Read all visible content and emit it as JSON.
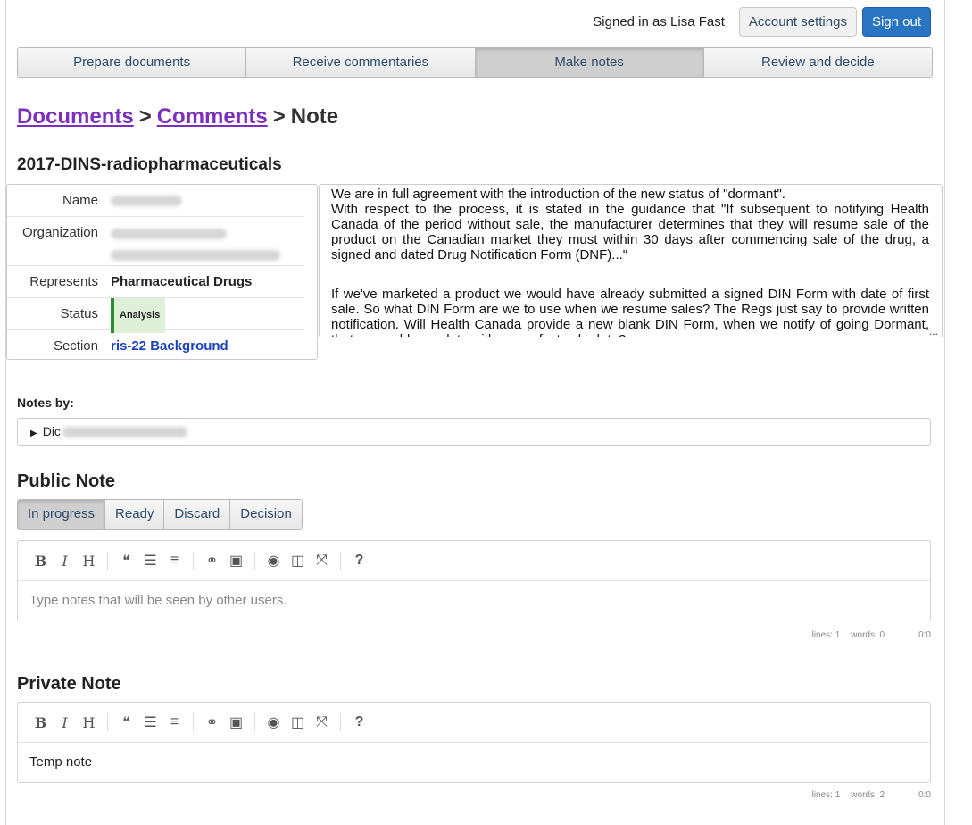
{
  "account": {
    "signed_in_text": "Signed in as Lisa Fast",
    "settings_label": "Account settings",
    "signout_label": "Sign out"
  },
  "nav": {
    "tabs": [
      "Prepare documents",
      "Receive commentaries",
      "Make notes",
      "Review and decide"
    ],
    "active": "Make notes"
  },
  "breadcrumb": {
    "documents": "Documents",
    "comments": "Comments",
    "separator": ">",
    "current": "Note"
  },
  "document": {
    "title": "2017-DINS-radiopharmaceuticals"
  },
  "details": {
    "name_label": "Name",
    "organization_label": "Organization",
    "represents_label": "Represents",
    "represents_value": "Pharmaceutical Drugs",
    "status_label": "Status",
    "status_value": "Analysis",
    "section_label": "Section",
    "section_value": "ris-22 Background"
  },
  "comment": {
    "p1": "We are in full agreement with the introduction of the new status of \"dormant\".",
    "p2": "With respect to the process, it is stated in the guidance that \"If subsequent to notifying Health Canada of the period without sale, the manufacturer determines that they will resume sale of the product on the Canadian market they must within 30 days after commencing sale of the drug, a signed and dated Drug Notification Form (DNF)...\"",
    "p3": "If we've marketed a product we would have already submitted a signed DIN Form with date of first sale. So what DIN Form are we to use when we resume sales? The Regs just say to provide written notification. Will Health Canada provide a new blank DIN Form, when we notify of going Dormant, that we could complete with a new first sale date?",
    "more": "..."
  },
  "notes_by": {
    "label": "Notes by:",
    "author_visible": "Dic"
  },
  "public_note": {
    "heading": "Public Note",
    "states": [
      "In progress",
      "Ready",
      "Discard",
      "Decision"
    ],
    "active_state": "In progress",
    "placeholder": "Type notes that will be seen by other users.",
    "lines": "lines: 1",
    "words": "words: 0",
    "cursor": "0:0"
  },
  "private_note": {
    "heading": "Private Note",
    "text": "Temp note",
    "lines": "lines: 1",
    "words": "words: 2",
    "cursor": "0:0"
  },
  "toolbar_icons": {
    "bold": "B",
    "italic": "I",
    "heading": "H",
    "quote": "❝",
    "ul": "☰",
    "ol": "≡",
    "link": "⚭",
    "image": "▣",
    "preview": "◉",
    "side": "◫",
    "fullscreen": "⤧",
    "help": "?"
  }
}
